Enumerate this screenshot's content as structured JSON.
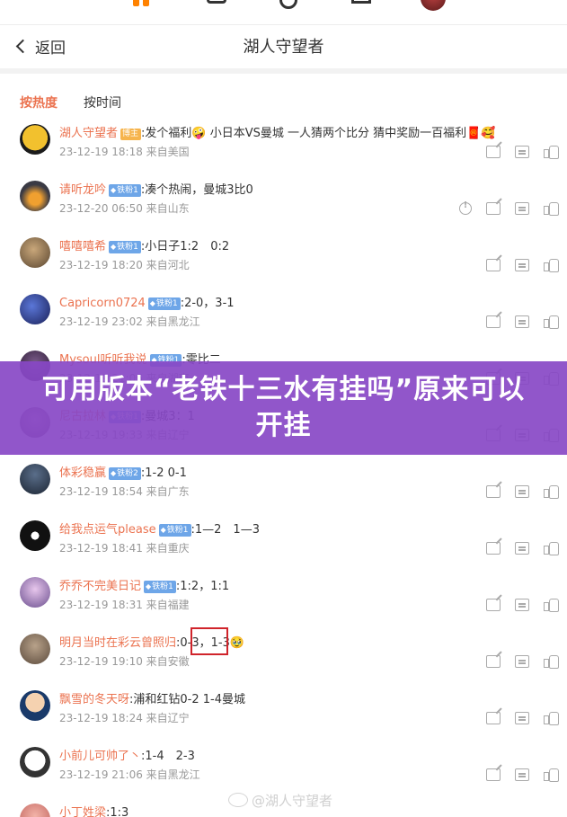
{
  "nav": {
    "back_label": "返回",
    "title": "湖人守望者"
  },
  "sort": {
    "hot": "按热度",
    "time": "按时间"
  },
  "comments": [
    {
      "user": "湖人守望者",
      "badge": "博主",
      "text": ":发个福利🤪 小日本VS曼城 一人猜两个比分 猜中奖励一百福利🧧🥰",
      "meta": "23-12-19 18:18 来自美国"
    },
    {
      "user": "请听龙吟",
      "badge": "铁粉1",
      "text": ":凑个热闹，曼城3比0",
      "meta": "23-12-20 06:50 来自山东"
    },
    {
      "user": "嘻嘻嘻希",
      "badge": "铁粉1",
      "text": ":小日子1:2　0:2",
      "meta": "23-12-19 18:20 来自河北"
    },
    {
      "user": "Capricorn0724",
      "badge": "铁粉1",
      "text": ":2-0，3-1",
      "meta": "23-12-19 23:02 来自黑龙江"
    },
    {
      "user": "Mysoul听听我说",
      "badge": "铁粉1",
      "text": ":零比二",
      "meta": "23-12-19 21:06 来自湖南"
    },
    {
      "user": "尼古拉林",
      "badge": "铁粉1",
      "text": ":曼城3：1",
      "meta": "23-12-19 19:33 来自辽宁"
    },
    {
      "user": "体彩稳赢",
      "badge": "铁粉2",
      "text": ":1-2 0-1",
      "meta": "23-12-19 18:54 来自广东"
    },
    {
      "user": "给我点运气please",
      "badge": "铁粉1",
      "text": ":1—2　1—3",
      "meta": "23-12-19 18:41 来自重庆"
    },
    {
      "user": "乔乔不完美日记",
      "badge": "铁粉1",
      "text": ":1:2，1:1",
      "meta": "23-12-19 18:31 来自福建"
    },
    {
      "user": "明月当时在彩云曾照归",
      "badge": "",
      "text": ":0-3，1-3🥹",
      "meta": "23-12-19 19:10 来自安徽"
    },
    {
      "user": "飘雪的冬天呀",
      "badge": "",
      "text": ":浦和红钻0-2 1-4曼城",
      "meta": "23-12-19 18:24 来自辽宁"
    },
    {
      "user": "小前儿可帅了丶",
      "badge": "",
      "text": ":1-4　2-3",
      "meta": "23-12-19 21:06 来自黑龙江"
    },
    {
      "user": "小丁姓梁",
      "badge": "",
      "text": ":1:3",
      "meta": ""
    }
  ],
  "banner": {
    "text": "可用版本“老铁十三水有挂吗”原来可以开挂"
  },
  "watermark": "@湖人守望者",
  "colors": {
    "accent": "#eb7350",
    "banner_bg": "#8848c6",
    "badge_blue": "#6ea6e8",
    "highlight_box": "#d0242b"
  }
}
